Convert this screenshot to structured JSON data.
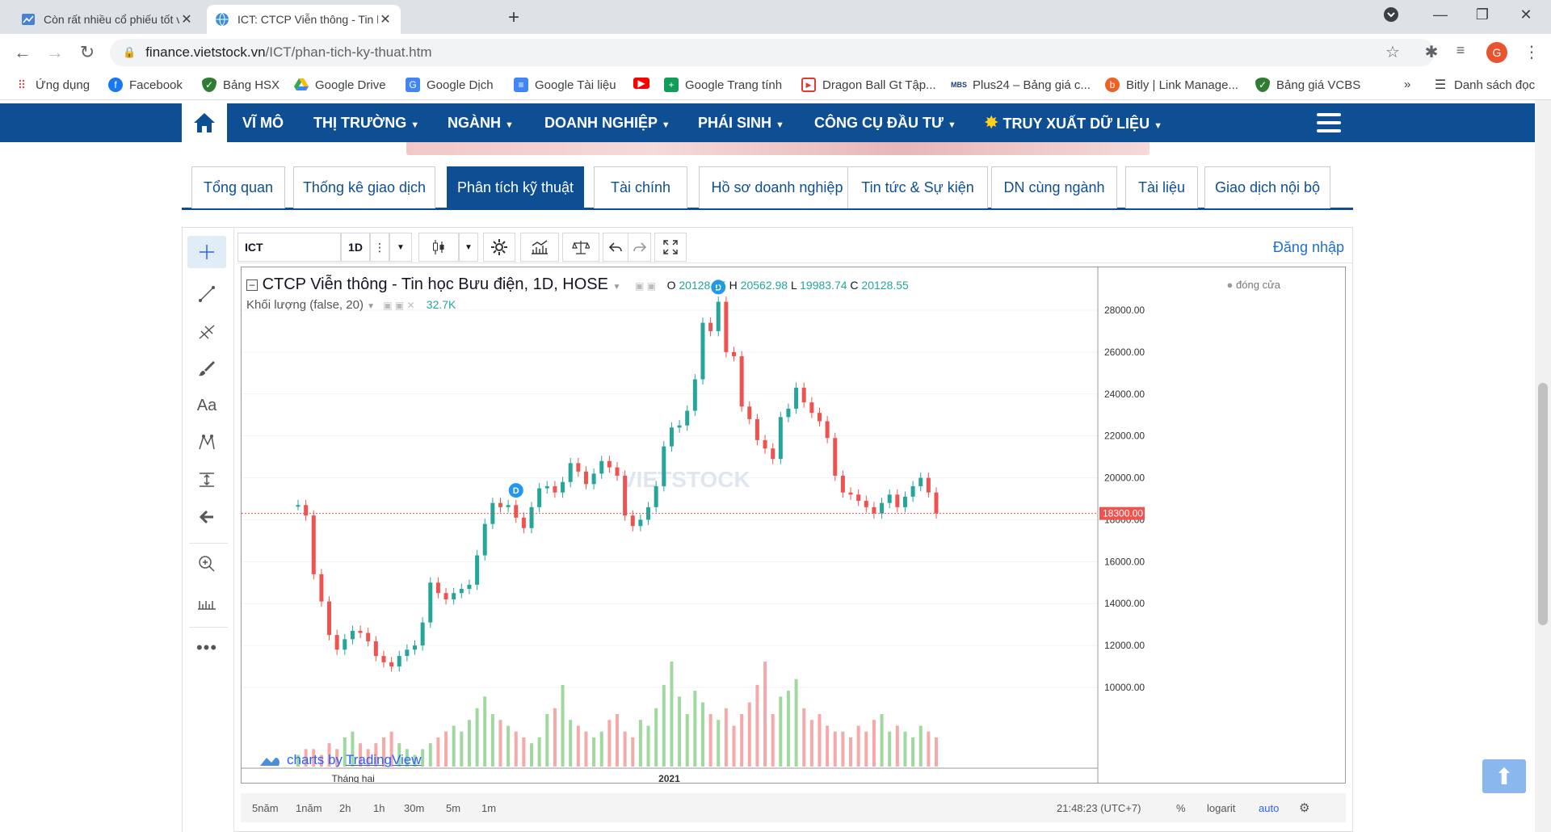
{
  "browser": {
    "tabs": [
      {
        "title": "Còn rất nhiều cổ phiếu tốt với gi",
        "active": false
      },
      {
        "title": "ICT: CTCP Viễn thông - Tin học Bư",
        "active": true
      }
    ],
    "url_host": "finance.vietstock.vn",
    "url_path": "/ICT/phan-tich-ky-thuat.htm",
    "profile_initial": "G",
    "bookmarks": [
      "Ứng dụng",
      "Facebook",
      "Bảng HSX",
      "Google Drive",
      "Google Dịch",
      "Google Tài liệu",
      "",
      "Google Trang tính",
      "Dragon Ball Gt Tập...",
      "Plus24 – Bảng giá c...",
      "Bitly | Link Manage...",
      "Bảng giá VCBS"
    ],
    "bookmarks_more": "»",
    "reading_list": "Danh sách đọc"
  },
  "site": {
    "nav": [
      "VĨ MÔ",
      "THỊ TRƯỜNG",
      "NGÀNH",
      "DOANH NGHIỆP",
      "PHÁI SINH",
      "CÔNG CỤ ĐẦU TƯ",
      "TRUY XUẤT DỮ LIỆU"
    ],
    "subtabs": [
      "Tổng quan",
      "Thống kê giao dịch",
      "Phân tích kỹ thuật",
      "Tài chính",
      "Hồ sơ doanh nghiệp",
      "Tin tức & Sự kiện",
      "DN cùng ngành",
      "Tài liệu",
      "Giao dịch nội bộ"
    ],
    "active_subtab": 2
  },
  "chart_ui": {
    "symbol": "ICT",
    "interval": "1D",
    "login": "Đăng nhập",
    "title": "CTCP Viễn thông - Tin học Bưu điện, 1D, HOSE",
    "ohlc": {
      "O": "20128.55",
      "H": "20562.98",
      "L": "19983.74",
      "C": "20128.55"
    },
    "volume_label": "Khối lượng (false, 20)",
    "volume_value": "32.7K",
    "closed_label": "đóng cửa",
    "price_label": "18300.00",
    "watermark": "VIETSTOCK",
    "tv_credit": "charts by",
    "tv_link": "TradingView",
    "ranges": [
      "5năm",
      "1năm",
      "2h",
      "1h",
      "30m",
      "5m",
      "1m"
    ],
    "time": "21:48:23 (UTC+7)",
    "pct": "%",
    "log": "logarit",
    "auto": "auto",
    "font_label": "Aa"
  },
  "chart_data": {
    "type": "line",
    "title": "CTCP Viễn thông - Tin học Bưu điện, 1D, HOSE",
    "yticks": [
      "28000.00",
      "26000.00",
      "24000.00",
      "22000.00",
      "20000.00",
      "18000.00",
      "16000.00",
      "14000.00",
      "12000.00",
      "10000.00"
    ],
    "ylim": [
      10000,
      28500
    ],
    "xticks": [
      "Tháng hai",
      "2021"
    ],
    "last_price": 18300,
    "series": [
      {
        "name": "ICT",
        "values": [
          18700,
          18200,
          15400,
          14100,
          12500,
          11800,
          12300,
          12700,
          12600,
          12200,
          11500,
          11200,
          11000,
          11500,
          11800,
          12000,
          13100,
          15000,
          14500,
          14200,
          14500,
          14700,
          14900,
          16300,
          17800,
          18800,
          18600,
          18700,
          18100,
          17600,
          18600,
          19500,
          19600,
          19300,
          19800,
          20700,
          20300,
          19700,
          20200,
          20800,
          20500,
          20100,
          18200,
          17700,
          18000,
          18600,
          19600,
          21500,
          22400,
          22500,
          23200,
          24700,
          27400,
          27000,
          28400,
          26000,
          25800,
          23400,
          22800,
          21800,
          21400,
          20900,
          22900,
          23300,
          24300,
          23600,
          23100,
          22700,
          21900,
          20100,
          19300,
          19200,
          18900,
          18600,
          18300,
          18800,
          19200,
          18600,
          19100,
          19600,
          20000,
          19300,
          18300
        ]
      }
    ],
    "volume": [
      2,
      3,
      3,
      2,
      4,
      3,
      5,
      6,
      4,
      3,
      4,
      5,
      6,
      4,
      3,
      2,
      3,
      4,
      5,
      6,
      7,
      6,
      8,
      10,
      12,
      9,
      8,
      7,
      6,
      5,
      4,
      5,
      9,
      10,
      14,
      8,
      7,
      6,
      5,
      6,
      8,
      9,
      6,
      5,
      8,
      7,
      10,
      14,
      18,
      12,
      9,
      13,
      11,
      9,
      8,
      10,
      7,
      9,
      11,
      14,
      18,
      9,
      12,
      13,
      15,
      10,
      8,
      9,
      7,
      6,
      6,
      5,
      7,
      6,
      8,
      9,
      6,
      7,
      6,
      5,
      7,
      6,
      5
    ],
    "markers": [
      "D",
      "D"
    ]
  }
}
